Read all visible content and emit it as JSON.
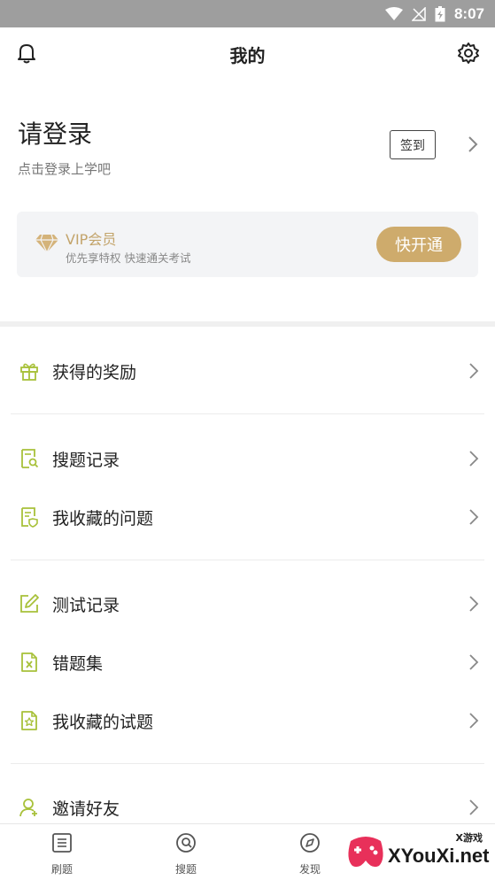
{
  "status_bar": {
    "time": "8:07"
  },
  "header": {
    "title": "我的",
    "left_icon": "bell-icon",
    "right_icon": "gear-icon"
  },
  "login": {
    "title": "请登录",
    "subtitle": "点击登录上学吧",
    "signin_label": "签到"
  },
  "vip": {
    "title": "VIP会员",
    "subtitle": "优先享特权 快速通关考试",
    "button_label": "快开通",
    "accent": "#ceab6c"
  },
  "menu": {
    "items": [
      {
        "label": "获得的奖励",
        "icon": "gift-icon"
      },
      {
        "label": "搜题记录",
        "icon": "search-record-icon"
      },
      {
        "label": "我收藏的问题",
        "icon": "favorite-question-icon"
      },
      {
        "label": "测试记录",
        "icon": "edit-icon"
      },
      {
        "label": "错题集",
        "icon": "wrong-file-icon"
      },
      {
        "label": "我收藏的试题",
        "icon": "favorite-test-icon"
      },
      {
        "label": "邀请好友",
        "icon": "invite-friends-icon"
      }
    ],
    "icon_color": "#a8c13a"
  },
  "tabbar": {
    "tabs": [
      {
        "label": "刷题",
        "icon": "list-icon"
      },
      {
        "label": "搜题",
        "icon": "search-icon"
      },
      {
        "label": "发现",
        "icon": "compass-icon"
      }
    ]
  },
  "watermark": {
    "top": "X游戏",
    "main": "XYouXi.net"
  }
}
